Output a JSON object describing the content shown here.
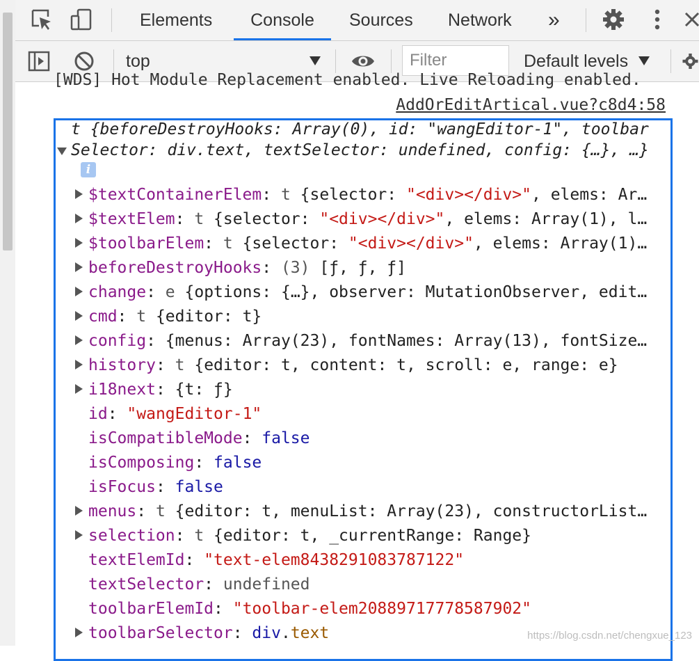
{
  "tabs": {
    "elements": "Elements",
    "console": "Console",
    "sources": "Sources",
    "network": "Network",
    "more": "»"
  },
  "toolbar": {
    "context": "top",
    "filter_placeholder": "Filter",
    "levels": "Default levels"
  },
  "console": {
    "clipped_line": "[WDS] Hot Module Replacement enabled. Live Reloading enabled.",
    "source_link": "AddOrEditArtical.vue?c8d4:58",
    "summary_line1": "t {beforeDestroyHooks: Array(0), id: \"wangEditor-1\", toolbar",
    "summary_line2": "Selector: div.text, textSelector: undefined, config: {…}, …}",
    "info_icon_label": "i",
    "rows": [
      {
        "expand": true,
        "key": "$textContainerElem",
        "pre": "t",
        "value": " {selector: ",
        "str": "\"<div></div>\"",
        "rest": ", elems: Ar…"
      },
      {
        "expand": true,
        "key": "$textElem",
        "pre": "t",
        "value": " {selector: ",
        "str": "\"<div></div>\"",
        "rest": ", elems: Array(1), l…"
      },
      {
        "expand": true,
        "key": "$toolbarElem",
        "pre": "t",
        "value": " {selector: ",
        "str": "\"<div></div>\"",
        "rest": ", elems: Array(1)…"
      },
      {
        "expand": true,
        "key": "beforeDestroyHooks",
        "pre": "(3)",
        "value": " [ƒ, ƒ, ƒ]",
        "str": "",
        "rest": ""
      },
      {
        "expand": true,
        "key": "change",
        "pre": "e",
        "value": " {options: {…}, observer: MutationObserver, edit…",
        "str": "",
        "rest": ""
      },
      {
        "expand": true,
        "key": "cmd",
        "pre": "t",
        "value": " {editor: t}",
        "str": "",
        "rest": ""
      },
      {
        "expand": true,
        "key": "config",
        "pre": "",
        "value": "{menus: Array(23), fontNames: Array(13), fontSize…",
        "str": "",
        "rest": ""
      },
      {
        "expand": true,
        "key": "history",
        "pre": "t",
        "value": " {editor: t, content: t, scroll: e, range: e}",
        "str": "",
        "rest": ""
      },
      {
        "expand": true,
        "key": "i18next",
        "pre": "",
        "value": "{t: ƒ}",
        "str": "",
        "rest": ""
      },
      {
        "expand": false,
        "key": "id",
        "pre": "",
        "value": "",
        "str": "\"wangEditor-1\"",
        "rest": ""
      },
      {
        "expand": false,
        "key": "isCompatibleMode",
        "pre": "",
        "value": "",
        "bool": "false"
      },
      {
        "expand": false,
        "key": "isComposing",
        "pre": "",
        "value": "",
        "bool": "false"
      },
      {
        "expand": false,
        "key": "isFocus",
        "pre": "",
        "value": "",
        "bool": "false"
      },
      {
        "expand": true,
        "key": "menus",
        "pre": "t",
        "value": " {editor: t, menuList: Array(23), constructorList…",
        "str": "",
        "rest": ""
      },
      {
        "expand": true,
        "key": "selection",
        "pre": "t",
        "value": " {editor: t, _currentRange: Range}",
        "str": "",
        "rest": ""
      },
      {
        "expand": false,
        "key": "textElemId",
        "pre": "",
        "value": "",
        "str": "\"text-elem8438291083787122\"",
        "rest": ""
      },
      {
        "expand": false,
        "key": "textSelector",
        "pre": "",
        "value": "undefined",
        "str": "",
        "rest": ""
      },
      {
        "expand": false,
        "key": "toolbarElemId",
        "pre": "",
        "value": "",
        "str": "\"toolbar-elem20889717778587902\"",
        "rest": ""
      },
      {
        "expand": true,
        "key": "toolbarSelector",
        "pre": "",
        "value": "div.text",
        "str": "",
        "rest": ""
      }
    ]
  },
  "watermark": "https://blog.csdn.net/chengxue_123"
}
